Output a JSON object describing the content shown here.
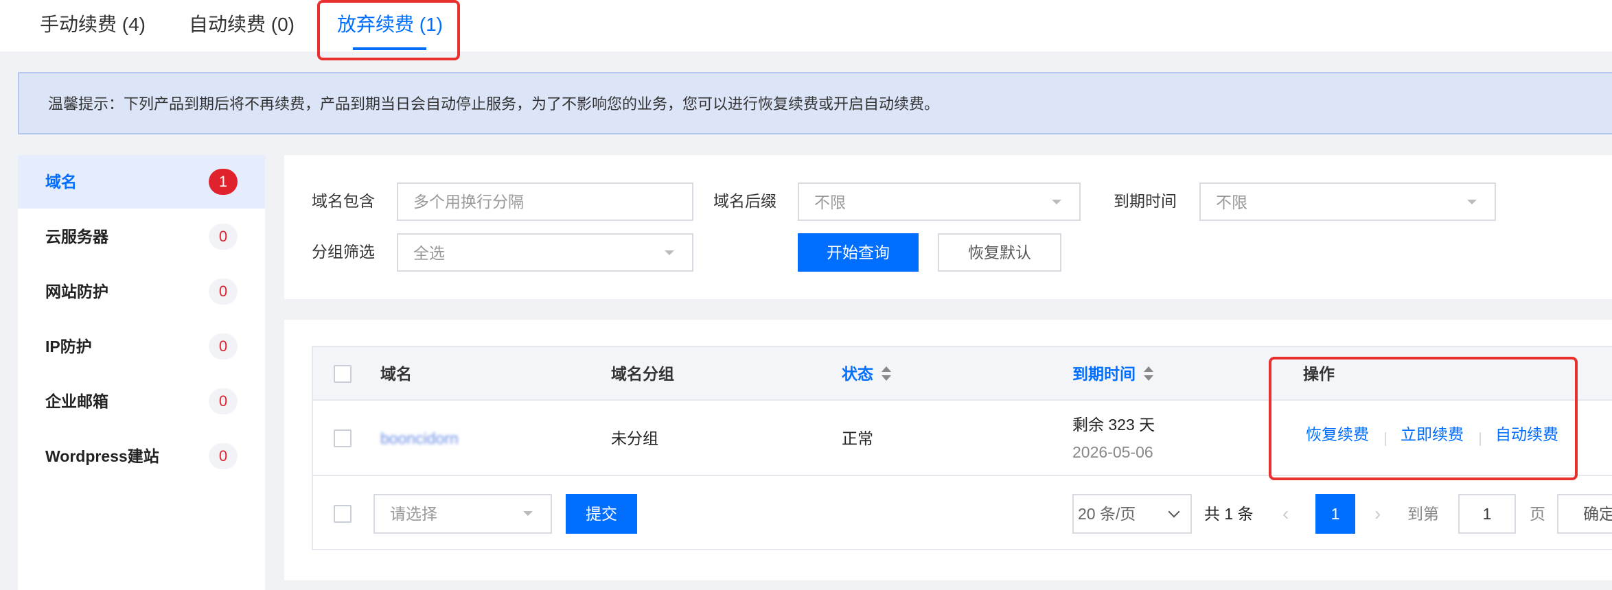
{
  "tabs": [
    {
      "label": "手动续费 (4)"
    },
    {
      "label": "自动续费 (0)"
    },
    {
      "label": "放弃续费 (1)"
    }
  ],
  "notice": "温馨提示：下列产品到期后将不再续费，产品到期当日会自动停止服务，为了不影响您的业务，您可以进行恢复续费或开启自动续费。",
  "sidebar": {
    "items": [
      {
        "label": "域名",
        "count": "1"
      },
      {
        "label": "云服务器",
        "count": "0"
      },
      {
        "label": "网站防护",
        "count": "0"
      },
      {
        "label": "IP防护",
        "count": "0"
      },
      {
        "label": "企业邮箱",
        "count": "0"
      },
      {
        "label": "Wordpress建站",
        "count": "0"
      }
    ]
  },
  "filter": {
    "domain_contains_label": "域名包含",
    "domain_contains_placeholder": "多个用换行分隔",
    "suffix_label": "域名后缀",
    "suffix_value": "不限",
    "expire_label": "到期时间",
    "expire_value": "不限",
    "group_label": "分组筛选",
    "group_value": "全选",
    "search_button": "开始查询",
    "reset_button": "恢复默认"
  },
  "table": {
    "headers": {
      "domain": "域名",
      "group": "域名分组",
      "status": "状态",
      "expire": "到期时间",
      "actions": "操作"
    },
    "rows": [
      {
        "domain": "booncidorn",
        "group": "未分组",
        "status": "正常",
        "remaining": "剩余 323 天",
        "expire_date": "2026-05-06",
        "actions": [
          "恢复续费",
          "立即续费",
          "自动续费"
        ]
      }
    ]
  },
  "footer": {
    "bulk_placeholder": "请选择",
    "submit_button": "提交",
    "page_size": "20 条/页",
    "total": "共 1 条",
    "current_page": "1",
    "goto_label": "到第",
    "goto_value": "1",
    "page_unit": "页",
    "confirm_button": "确定"
  },
  "colors": {
    "primary": "#006eff",
    "highlight_box": "#e8312f",
    "badge_red": "#e0222c"
  }
}
